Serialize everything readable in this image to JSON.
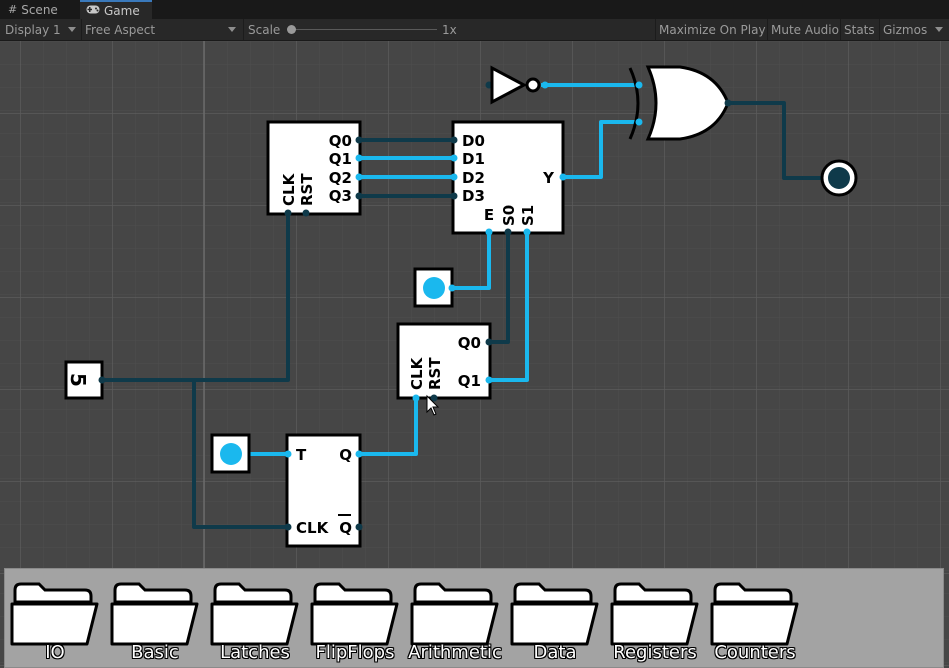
{
  "tabs": [
    {
      "label": "Scene",
      "icon": "grid-icon"
    },
    {
      "label": "Game",
      "icon": "gamepad-icon"
    }
  ],
  "toolbar": {
    "display": "Display 1",
    "aspect": "Free Aspect",
    "scale_label": "Scale",
    "scale_value": "1x",
    "maximize": "Maximize On Play",
    "mute": "Mute Audio",
    "stats": "Stats",
    "gizmos": "Gizmos"
  },
  "circuit": {
    "counter_top": {
      "pins_out": [
        "Q0",
        "Q1",
        "Q2",
        "Q3"
      ],
      "pins_in": [
        "CLK",
        "RST"
      ]
    },
    "mux": {
      "pins_in": [
        "D0",
        "D1",
        "D2",
        "D3"
      ],
      "pins_sel": [
        "E",
        "S0",
        "S1"
      ],
      "pin_out": "Y"
    },
    "counter_small": {
      "pins_out": [
        "Q0",
        "Q1"
      ],
      "pins_in": [
        "CLK",
        "RST"
      ]
    },
    "tflipflop": {
      "pin_t": "T",
      "pin_q": "Q",
      "pin_clk": "CLK",
      "pin_qbar": "Q"
    },
    "clock": {
      "label": "5"
    },
    "colors": {
      "wire_on": "#1ab8ee",
      "wire_off": "#0f3a4a",
      "background": "#464646",
      "grid": "#525252"
    }
  },
  "palette": {
    "folders": [
      "IO",
      "Basic",
      "Latches",
      "FlipFlops",
      "Arithmetic",
      "Data",
      "Registers",
      "Counters"
    ]
  }
}
